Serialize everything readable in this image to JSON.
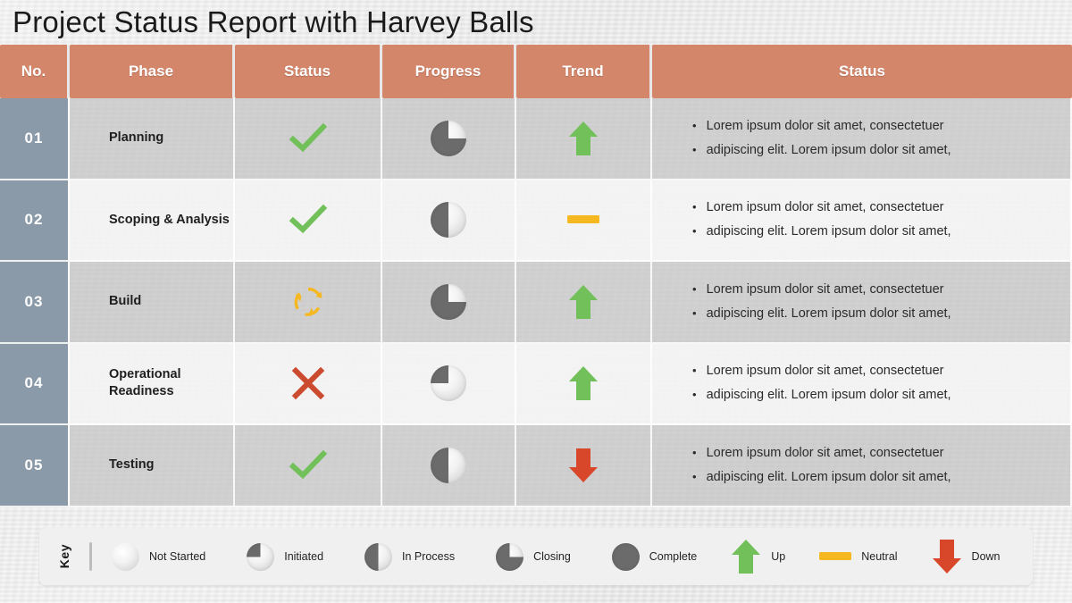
{
  "slide": {
    "title": "Project Status Report with Harvey Balls"
  },
  "colors": {
    "header_orange": "#d4866a",
    "number_blue_gray": "#8a9aa8",
    "check_green": "#72c05a",
    "cross_red": "#cc4b2e",
    "refresh_yellow": "#f5b820",
    "trend_up_green": "#72c05a",
    "trend_neutral_yellow": "#f5b820",
    "trend_down_red": "#d9472b",
    "ball_fill_gray": "#6b6b6b",
    "background": "#e8e8e8"
  },
  "table": {
    "headers": [
      {
        "label": "No."
      },
      {
        "label": "Phase"
      },
      {
        "label": "Status"
      },
      {
        "label": "Progress"
      },
      {
        "label": "Trend"
      },
      {
        "label": "Status"
      }
    ],
    "rows": [
      {
        "no": "01",
        "phase": "Planning",
        "status_icon": "check-icon",
        "progress_percent": 75,
        "progress_label": "Closing",
        "trend_icon": "arrow-up-icon",
        "trend_label": "Up",
        "bullets": [
          "Lorem ipsum dolor sit amet, consectetuer",
          "adipiscing elit. Lorem ipsum dolor sit amet,"
        ]
      },
      {
        "no": "02",
        "phase": "Scoping & Analysis",
        "status_icon": "check-icon",
        "progress_percent": 50,
        "progress_label": "In Process",
        "trend_icon": "neutral-bar-icon",
        "trend_label": "Neutral",
        "bullets": [
          "Lorem ipsum dolor sit amet, consectetuer",
          "adipiscing elit. Lorem ipsum dolor sit amet,"
        ]
      },
      {
        "no": "03",
        "phase": "Build",
        "status_icon": "refresh-icon",
        "progress_percent": 75,
        "progress_label": "Closing",
        "trend_icon": "arrow-up-icon",
        "trend_label": "Up",
        "bullets": [
          "Lorem ipsum dolor sit amet, consectetuer",
          "adipiscing elit. Lorem ipsum dolor sit amet,"
        ]
      },
      {
        "no": "04",
        "phase": "Operational Readiness",
        "status_icon": "cross-icon",
        "progress_percent": 25,
        "progress_label": "Initiated",
        "trend_icon": "arrow-up-icon",
        "trend_label": "Up",
        "bullets": [
          "Lorem ipsum dolor sit amet, consectetuer",
          "adipiscing elit. Lorem ipsum dolor sit amet,"
        ]
      },
      {
        "no": "05",
        "phase": "Testing",
        "status_icon": "check-icon",
        "progress_percent": 50,
        "progress_label": "In Process",
        "trend_icon": "arrow-down-icon",
        "trend_label": "Down",
        "bullets": [
          "Lorem ipsum dolor sit amet, consectetuer",
          "adipiscing elit. Lorem ipsum dolor sit amet,"
        ]
      }
    ]
  },
  "key": {
    "label": "Key",
    "items": [
      {
        "icon": "harvey-ball-0",
        "percent": 0,
        "label": "Not Started"
      },
      {
        "icon": "harvey-ball-25",
        "percent": 25,
        "label": "Initiated"
      },
      {
        "icon": "harvey-ball-50",
        "percent": 50,
        "label": "In Process"
      },
      {
        "icon": "harvey-ball-75",
        "percent": 75,
        "label": "Closing"
      },
      {
        "icon": "harvey-ball-100",
        "percent": 100,
        "label": "Complete"
      },
      {
        "icon": "arrow-up-icon",
        "label": "Up"
      },
      {
        "icon": "neutral-bar-icon",
        "label": "Neutral"
      },
      {
        "icon": "arrow-down-icon",
        "label": "Down"
      }
    ]
  }
}
